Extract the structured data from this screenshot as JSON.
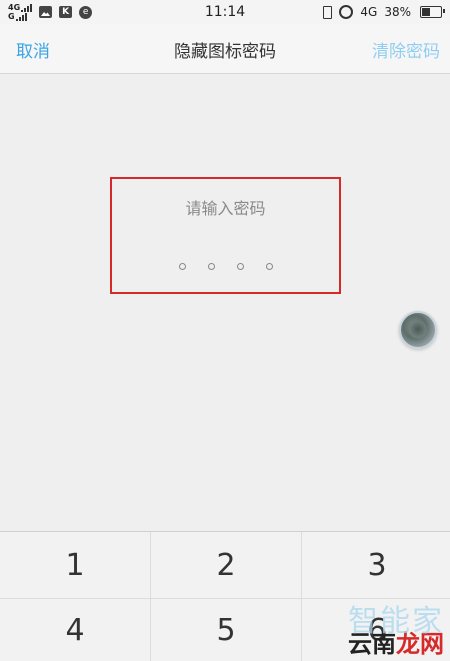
{
  "status_bar": {
    "network_top": "4G",
    "network_bottom": "G",
    "k_icon_label": "K",
    "refresh_icon_label": "e",
    "time": "11:14",
    "network_right": "4G",
    "battery": "38%"
  },
  "title_bar": {
    "cancel_label": "取消",
    "title": "隐藏图标密码",
    "clear_label": "清除密码"
  },
  "password": {
    "prompt": "请输入密码",
    "length": 4
  },
  "keypad": {
    "keys": [
      "1",
      "2",
      "3",
      "4",
      "5",
      "6"
    ]
  },
  "watermark": {
    "top": "智能家",
    "bottom_black": "云南",
    "bottom_red": "龙网"
  },
  "colors": {
    "accent": "#3aa3e6",
    "accent_disabled": "#8fcdf2",
    "highlight_box": "#d62a2a"
  },
  "icons": [
    "image-icon",
    "k-app-icon",
    "refresh-icon",
    "vibrate-icon",
    "alarm-icon",
    "battery-icon",
    "floating-ball-icon"
  ]
}
